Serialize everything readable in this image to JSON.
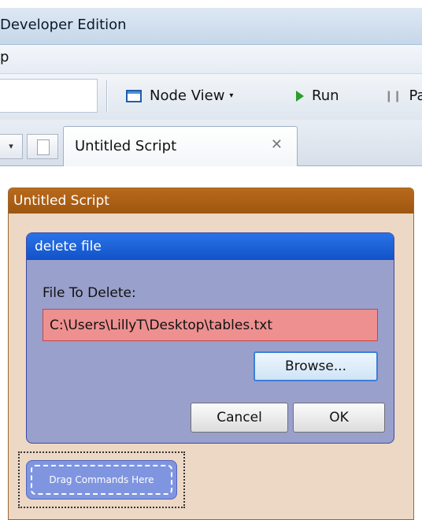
{
  "window": {
    "title": "Developer Edition"
  },
  "menubar": {
    "item": "p"
  },
  "toolbar": {
    "node_view_label": "Node View",
    "node_view_caret": "▾",
    "run_label": "Run",
    "pause_label": "Pa"
  },
  "tabs": {
    "dropdown_glyph": "▾",
    "active_label": "Untitled Script",
    "close_glyph": "✕"
  },
  "script": {
    "title": "Untitled Script",
    "command": {
      "title": "delete file",
      "field_label": "File To Delete:",
      "field_value": "C:\\Users\\LillyT\\Desktop\\tables.txt",
      "browse_label": "Browse...",
      "cancel_label": "Cancel",
      "ok_label": "OK"
    },
    "drag_label": "Drag Commands Here"
  },
  "colors": {
    "script_header": "#a65e14",
    "command_header": "#1a5fd6",
    "invalid_field": "#ee9090",
    "drag_zone": "#7f95e0"
  }
}
